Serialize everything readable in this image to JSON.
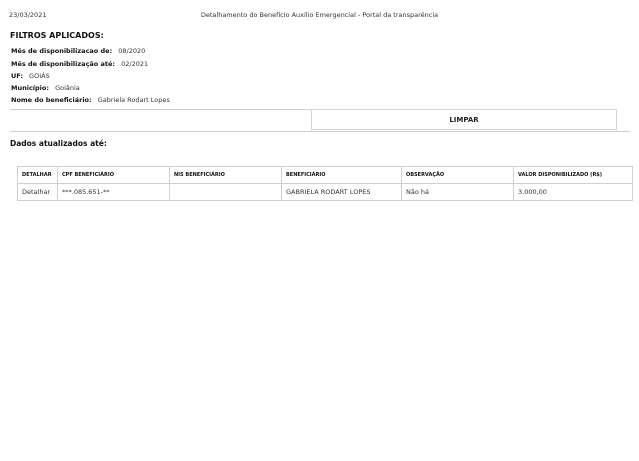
{
  "header": {
    "date": "23/03/2021",
    "title": "Detalhamento do Benefício Auxílio Emergencial - Portal da transparência"
  },
  "filters": {
    "title": "FILTROS APLICADOS:",
    "items": [
      {
        "label": "Mês de disponibilizacao de:",
        "value": "08/2020"
      },
      {
        "label": "Mês de disponibilização até:",
        "value": "02/2021"
      },
      {
        "label": "UF:",
        "value": "GOIÁS"
      },
      {
        "label": "Município:",
        "value": "Goiânia"
      },
      {
        "label": "Nome do beneficiário:",
        "value": "Gabriela Rodart Lopes"
      }
    ]
  },
  "actions": {
    "clear_label": "LIMPAR"
  },
  "updated_label": "Dados atualizados até:",
  "table": {
    "headers": [
      "DETALHAR",
      "CPF BENEFICIÁRIO",
      "NIS BENEFICIÁRIO",
      "BENEFICIÁRIO",
      "OBSERVAÇÃO",
      "VALOR DISPONIBILIZADO (R$)"
    ],
    "rows": [
      [
        "Detalhar",
        "***.085.651-**",
        "",
        "GABRIELA RODART LOPES",
        "Não há",
        "3.000,00"
      ]
    ]
  }
}
